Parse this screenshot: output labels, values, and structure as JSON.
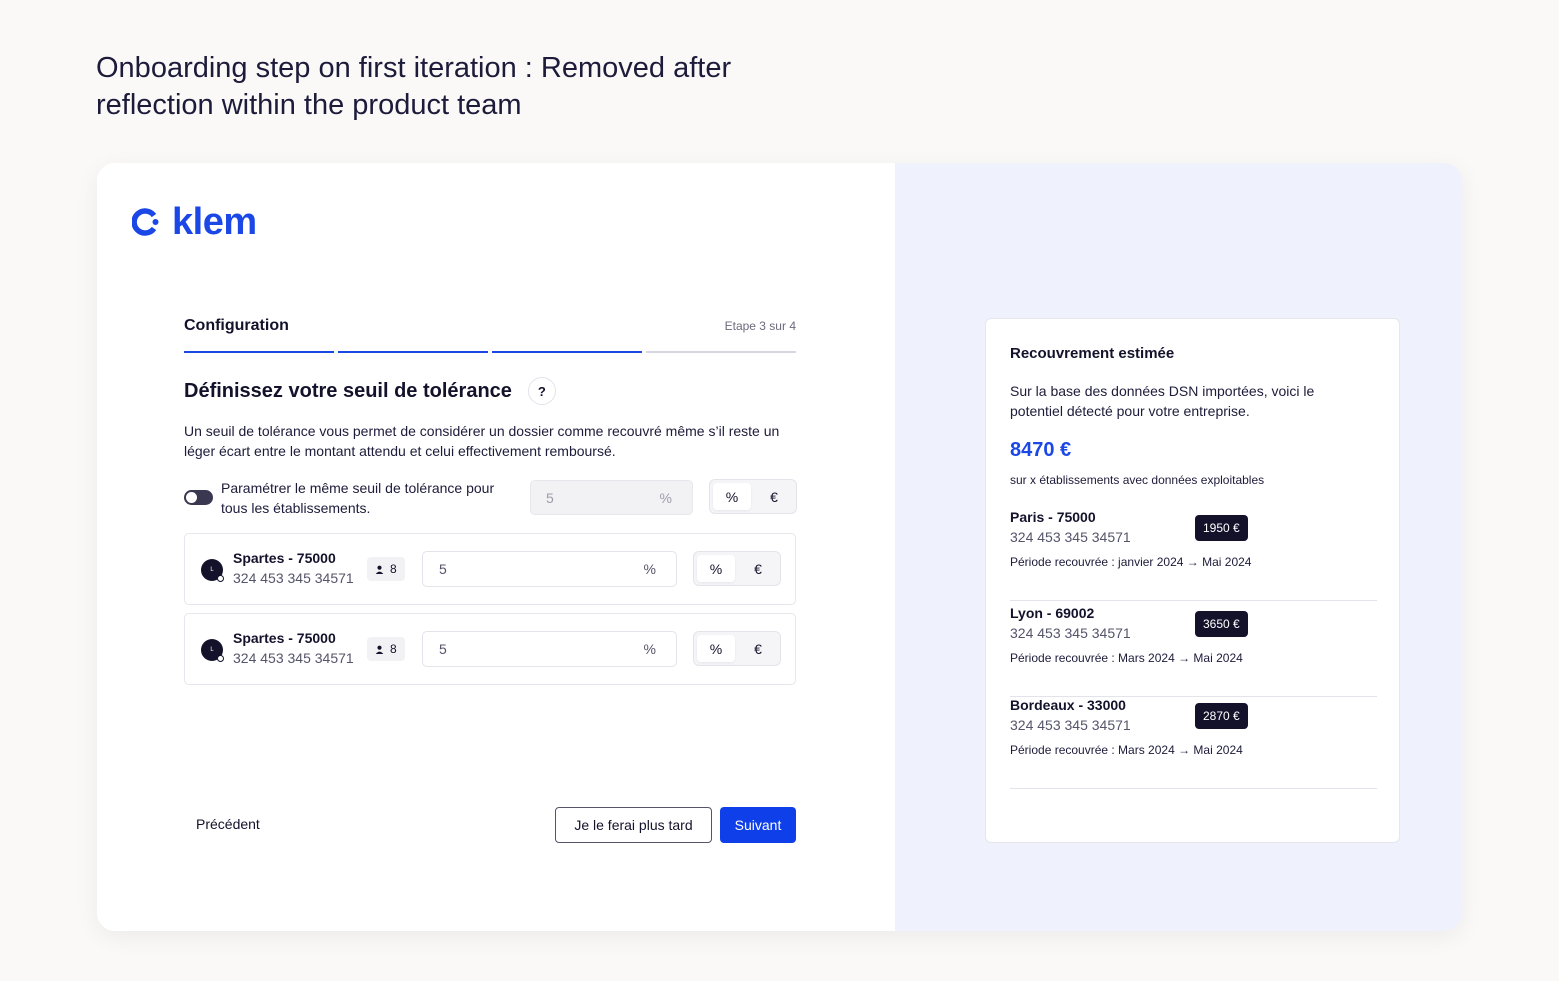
{
  "caption": "Onboarding step on first iteration : Removed after reflection within the product team",
  "brand": {
    "name": "klem",
    "color": "#1a47e6"
  },
  "step": {
    "title": "Configuration",
    "counter": "Etape 3 sur 4",
    "total": 4,
    "current": 3
  },
  "section": {
    "heading": "Définissez votre seuil de tolérance",
    "help": "?",
    "description": "Un seuil de tolérance vous permet de considérer un dossier comme recouvré même s’il reste un léger écart entre le montant attendu et celui effectivement remboursé."
  },
  "global_threshold": {
    "toggle_on": false,
    "label": "Paramétrer le même seuil de tolérance pour tous les établissements.",
    "value": "5",
    "unit_icon": "%",
    "options": [
      "%",
      "€"
    ],
    "selected": "%"
  },
  "establishments": [
    {
      "avatar": "L",
      "name": "Spartes - 75000",
      "siret": "324 453 345 34571",
      "employees": "8",
      "value": "5",
      "unit_icon": "%",
      "options": [
        "%",
        "€"
      ],
      "selected": "%"
    },
    {
      "avatar": "L",
      "name": "Spartes - 75000",
      "siret": "324 453 345 34571",
      "employees": "8",
      "value": "5",
      "unit_icon": "%",
      "options": [
        "%",
        "€"
      ],
      "selected": "%"
    }
  ],
  "footer": {
    "prev": "Précédent",
    "later": "Je le ferai plus tard",
    "next": "Suivant"
  },
  "recap": {
    "title": "Recouvrement estimée",
    "description": "Sur la base des données DSN importées, voici le potentiel détecté pour votre entreprise.",
    "amount": "8470 €",
    "subtitle": "sur x établissements avec données exploitables",
    "cities": [
      {
        "name": "Paris - 75000",
        "siret": "324 453 345 34571",
        "amount": "1950 €",
        "period": "Période recouvrée : janvier 2024 → Mai 2024"
      },
      {
        "name": "Lyon - 69002",
        "siret": "324 453 345 34571",
        "amount": "3650 €",
        "period": "Période recouvrée : Mars 2024 → Mai 2024"
      },
      {
        "name": "Bordeaux - 33000",
        "siret": "324 453 345 34571",
        "amount": "2870 €",
        "period": "Période recouvrée : Mars 2024 → Mai 2024"
      }
    ]
  },
  "colors": {
    "accent": "#1a47e6",
    "dark": "#14122b",
    "panel": "#eff1fd"
  }
}
